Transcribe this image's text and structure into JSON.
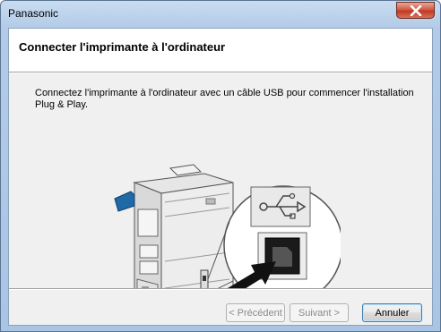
{
  "window": {
    "title": "Panasonic",
    "close_icon": "close-icon"
  },
  "header": {
    "title": "Connecter l'imprimante à l'ordinateur"
  },
  "main": {
    "instruction": "Connectez l'imprimante à l'ordinateur avec un câble USB pour commencer l'installation Plug & Play.",
    "illustration": {
      "icons": [
        "printer-illustration",
        "usb-icon",
        "usb-b-port-icon",
        "arrow-icon"
      ]
    }
  },
  "footer": {
    "back_label": "< Précédent",
    "next_label": "Suivant >",
    "cancel_label": "Annuler"
  },
  "colors": {
    "titlebar": "#b3cbe8",
    "close_button": "#c13a24",
    "panel": "#f0f0f0",
    "accent_blue": "#1f6aa6"
  }
}
